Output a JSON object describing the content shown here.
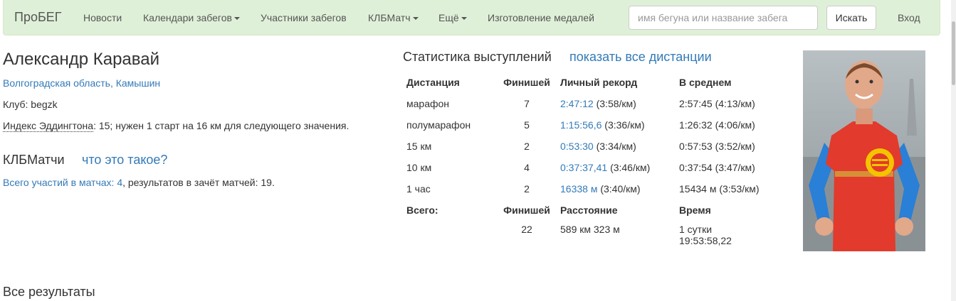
{
  "navbar": {
    "brand": "ПроБЕГ",
    "items": [
      {
        "label": "Новости",
        "dropdown": false
      },
      {
        "label": "Календари забегов",
        "dropdown": true
      },
      {
        "label": "Участники забегов",
        "dropdown": false
      },
      {
        "label": "КЛБМатч",
        "dropdown": true
      },
      {
        "label": "Ещё",
        "dropdown": true
      },
      {
        "label": "Изготовление медалей",
        "dropdown": false
      }
    ],
    "search_placeholder": "имя бегуна или название забега",
    "search_button": "Искать",
    "login": "Вход"
  },
  "runner": {
    "name": "Александр Каравай",
    "region": "Волгоградская область, Камышин",
    "club_label": "Клуб:",
    "club_value": "begzk",
    "eddington_label": "Индекс Эддингтона",
    "eddington_text": ": 15; нужен 1 старт на 16 км для следующего значения."
  },
  "klb": {
    "title": "КЛБМатчи",
    "help_link": "что это такое?",
    "participations_link": "Всего участий в матчах: 4",
    "results_text": ", результатов в зачёт матчей: 19."
  },
  "stats": {
    "title": "Статистика выступлений",
    "show_all_link": "показать все дистанции",
    "headers": [
      "Дистанция",
      "Финишей",
      "Личный рекорд",
      "В среднем"
    ],
    "rows": [
      {
        "distance": "марафон",
        "finishes": "7",
        "pb": "2:47:12",
        "pb_pace": "(3:58/км)",
        "avg": "2:57:45 (4:13/км)"
      },
      {
        "distance": "полумарафон",
        "finishes": "5",
        "pb": "1:15:56,6",
        "pb_pace": "(3:36/км)",
        "avg": "1:26:32 (4:06/км)"
      },
      {
        "distance": "15 км",
        "finishes": "2",
        "pb": "0:53:30",
        "pb_pace": "(3:34/км)",
        "avg": "0:57:53 (3:52/км)"
      },
      {
        "distance": "10 км",
        "finishes": "4",
        "pb": "0:37:37,41",
        "pb_pace": "(3:46/км)",
        "avg": "0:37:54 (3:47/км)"
      },
      {
        "distance": "1 час",
        "finishes": "2",
        "pb": "16338 м",
        "pb_pace": "(3:40/км)",
        "avg": "15434 м (3:53/км)"
      }
    ],
    "totals_headers": [
      "Всего:",
      "Финишей",
      "Расстояние",
      "Время"
    ],
    "totals": {
      "finishes": "22",
      "distance": "589 км 323 м",
      "time_line1": "1 сутки",
      "time_line2": "19:53:58,22"
    }
  },
  "all_results_title": "Все результаты",
  "colors": {
    "navbar_bg": "#dff0d8",
    "link": "#337ab7",
    "text": "#333333"
  }
}
